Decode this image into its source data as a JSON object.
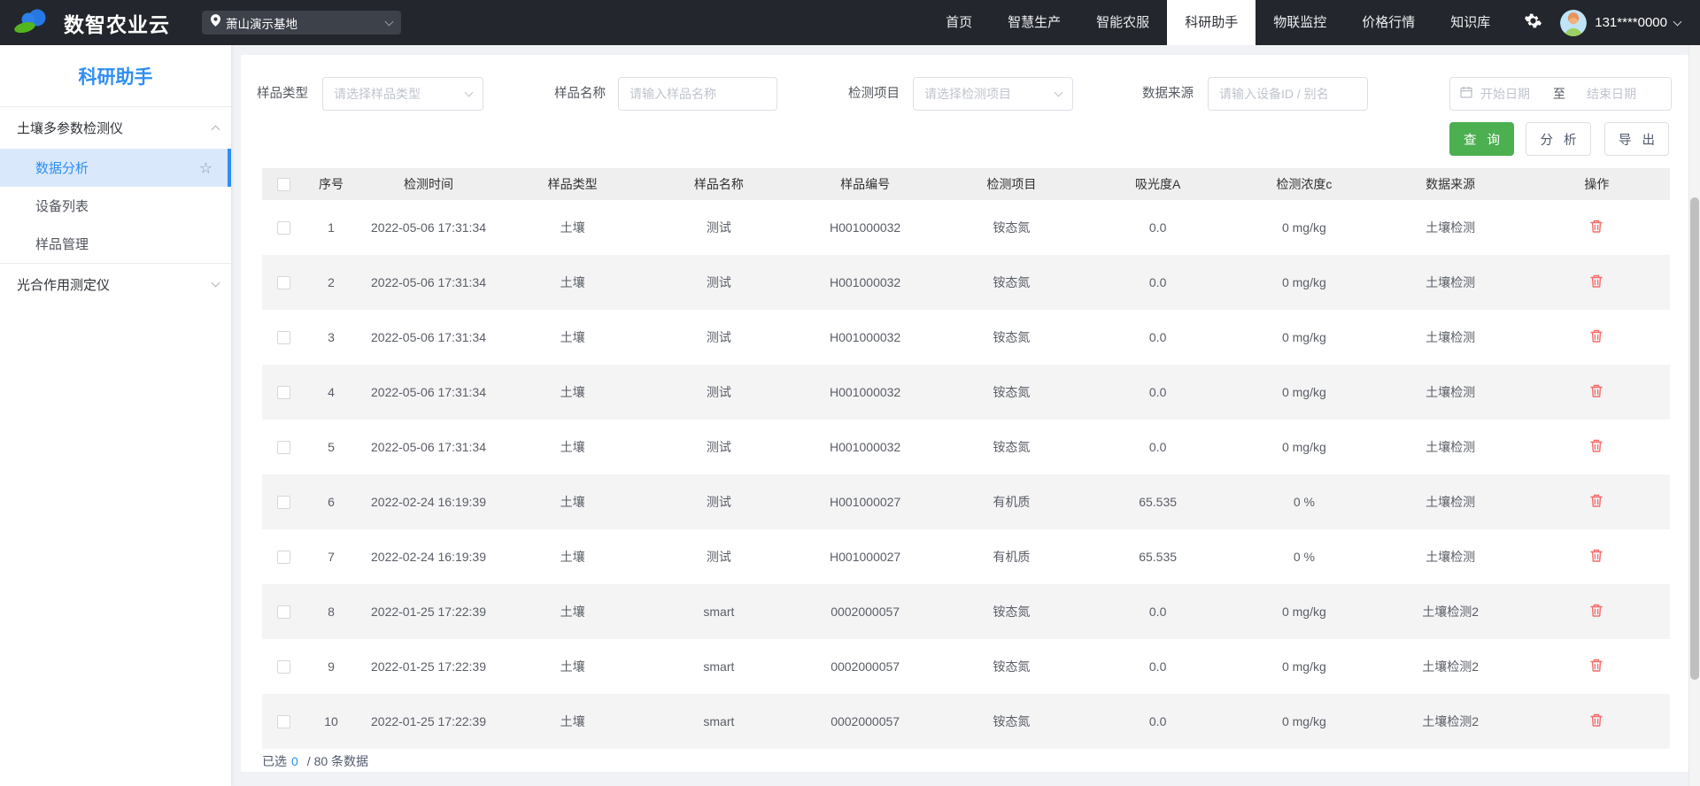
{
  "navbar": {
    "brand": "数智农业云",
    "base_selector": "萧山演示基地",
    "items": [
      {
        "id": "home",
        "label": "首页"
      },
      {
        "id": "smart-production",
        "label": "智慧生产"
      },
      {
        "id": "smart-service",
        "label": "智能农服"
      },
      {
        "id": "research-assistant",
        "label": "科研助手",
        "active": true
      },
      {
        "id": "iot-monitor",
        "label": "物联监控"
      },
      {
        "id": "price-market",
        "label": "价格行情"
      },
      {
        "id": "knowledge-base",
        "label": "知识库"
      }
    ],
    "user": "131****0000"
  },
  "sidebar": {
    "title": "科研助手",
    "groups": [
      {
        "label": "土壤多参数检测仪",
        "expanded": true,
        "children": [
          {
            "label": "数据分析",
            "active": true
          },
          {
            "label": "设备列表"
          },
          {
            "label": "样品管理"
          }
        ]
      },
      {
        "label": "光合作用测定仪",
        "expanded": false,
        "children": []
      }
    ]
  },
  "filters": {
    "sample_type": {
      "label": "样品类型",
      "placeholder": "请选择样品类型"
    },
    "sample_name": {
      "label": "样品名称",
      "placeholder": "请输入样品名称"
    },
    "test_item": {
      "label": "检测项目",
      "placeholder": "请选择检测项目"
    },
    "data_source": {
      "label": "数据来源",
      "placeholder": "请输入设备ID / 别名"
    },
    "date_range": {
      "start_placeholder": "开始日期",
      "separator": "至",
      "end_placeholder": "结束日期"
    },
    "buttons": {
      "query": "查 询",
      "analyze": "分 析",
      "export": "导 出"
    }
  },
  "table": {
    "columns": [
      "序号",
      "检测时间",
      "样品类型",
      "样品名称",
      "样品编号",
      "检测项目",
      "吸光度A",
      "检测浓度c",
      "数据来源",
      "操作"
    ],
    "rows": [
      {
        "no": "1",
        "time": "2022-05-06 17:31:34",
        "type": "土壤",
        "name": "测试",
        "code": "H001000032",
        "item": "铵态氮",
        "absorbance": "0.0",
        "concentration": "0 mg/kg",
        "source": "土壤检测"
      },
      {
        "no": "2",
        "time": "2022-05-06 17:31:34",
        "type": "土壤",
        "name": "测试",
        "code": "H001000032",
        "item": "铵态氮",
        "absorbance": "0.0",
        "concentration": "0 mg/kg",
        "source": "土壤检测"
      },
      {
        "no": "3",
        "time": "2022-05-06 17:31:34",
        "type": "土壤",
        "name": "测试",
        "code": "H001000032",
        "item": "铵态氮",
        "absorbance": "0.0",
        "concentration": "0 mg/kg",
        "source": "土壤检测"
      },
      {
        "no": "4",
        "time": "2022-05-06 17:31:34",
        "type": "土壤",
        "name": "测试",
        "code": "H001000032",
        "item": "铵态氮",
        "absorbance": "0.0",
        "concentration": "0 mg/kg",
        "source": "土壤检测"
      },
      {
        "no": "5",
        "time": "2022-05-06 17:31:34",
        "type": "土壤",
        "name": "测试",
        "code": "H001000032",
        "item": "铵态氮",
        "absorbance": "0.0",
        "concentration": "0 mg/kg",
        "source": "土壤检测"
      },
      {
        "no": "6",
        "time": "2022-02-24 16:19:39",
        "type": "土壤",
        "name": "测试",
        "code": "H001000027",
        "item": "有机质",
        "absorbance": "65.535",
        "concentration": "0 %",
        "source": "土壤检测"
      },
      {
        "no": "7",
        "time": "2022-02-24 16:19:39",
        "type": "土壤",
        "name": "测试",
        "code": "H001000027",
        "item": "有机质",
        "absorbance": "65.535",
        "concentration": "0 %",
        "source": "土壤检测"
      },
      {
        "no": "8",
        "time": "2022-01-25 17:22:39",
        "type": "土壤",
        "name": "smart",
        "code": "0002000057",
        "item": "铵态氮",
        "absorbance": "0.0",
        "concentration": "0 mg/kg",
        "source": "土壤检测2"
      },
      {
        "no": "9",
        "time": "2022-01-25 17:22:39",
        "type": "土壤",
        "name": "smart",
        "code": "0002000057",
        "item": "铵态氮",
        "absorbance": "0.0",
        "concentration": "0 mg/kg",
        "source": "土壤检测2"
      },
      {
        "no": "10",
        "time": "2022-01-25 17:22:39",
        "type": "土壤",
        "name": "smart",
        "code": "0002000057",
        "item": "铵态氮",
        "absorbance": "0.0",
        "concentration": "0 mg/kg",
        "source": "土壤检测2"
      }
    ]
  },
  "footer": {
    "prefix": "已选",
    "count": "0",
    "suffix": "/ 80 条数据"
  },
  "colors": {
    "accent": "#2f8ef3",
    "success": "#4caf50",
    "danger": "#f56c6c",
    "navbar_bg": "#23262c"
  }
}
